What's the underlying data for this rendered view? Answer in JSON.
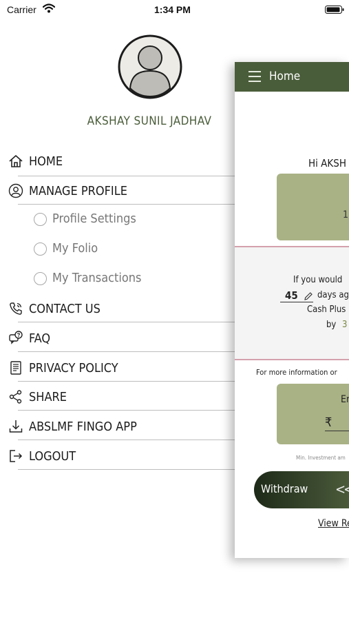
{
  "status_bar": {
    "carrier": "Carrier",
    "time": "1:34 PM"
  },
  "drawer": {
    "user_name": "AKSHAY SUNIL JADHAV",
    "menu": {
      "home": "HOME",
      "manage_profile": "MANAGE PROFILE",
      "profile_settings": "Profile Settings",
      "my_folio": "My Folio",
      "my_transactions": "My Transactions",
      "contact_us": "CONTACT US",
      "faq": "FAQ",
      "privacy_policy": "PRIVACY POLICY",
      "share": "SHARE",
      "fingo_app": "ABSLMF FINGO APP",
      "logout": "LOGOUT"
    }
  },
  "main": {
    "header_title": "Home",
    "greeting": "Hi AKSH",
    "balance_value": "1",
    "promo_line1": "If you would",
    "days_value": "45",
    "days_text": "days ag",
    "promo_line3": "Cash Plus",
    "by_text": "by",
    "by_value": "3",
    "more_info": "For more information or",
    "enter_text": "En",
    "currency_symbol": "₹",
    "min_investment": "Min. Investment am",
    "withdraw_label": "Withdraw",
    "withdraw_chevrons": "<<",
    "view_link": "View Re"
  },
  "colors": {
    "brand_green": "#4a5d3a",
    "card_green": "#a9b285",
    "accent_pink": "#d4a1ad"
  }
}
